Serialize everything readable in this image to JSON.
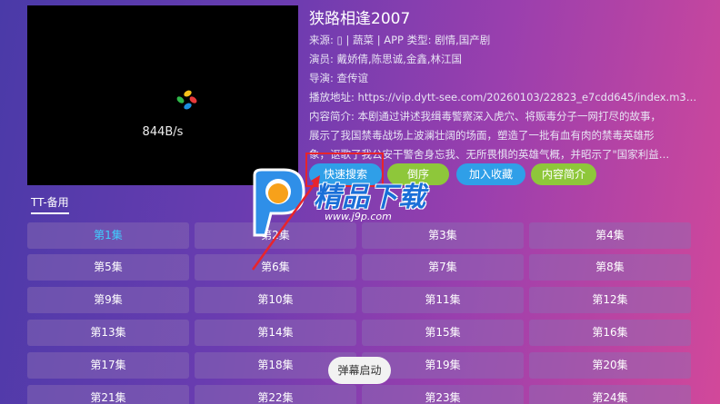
{
  "player": {
    "speed": "844B/s"
  },
  "info": {
    "title": "狭路相逢2007",
    "source_row": "来源: ▯ | 蔬菜 | APP  类型: 剧情,国产剧",
    "actors_row": "演员: 戴娇倩,陈思诚,金鑫,林江国",
    "director_row": "导演: 查传谊",
    "url_row": "播放地址: https://vip.dytt-see.com/20260103/22823_e7cdd645/index.m3u...",
    "desc_line1": "内容简介: 本剧通过讲述我缉毒警察深入虎穴、将贩毒分子一网打尽的故事，",
    "desc_line2": "展示了我国禁毒战场上波澜壮阔的场面，塑造了一批有血有肉的禁毒英雄形",
    "desc_line3": "象，讴歌了我公安干警舍身忘我、无所畏惧的英雄气概，并昭示了\"国家利益…"
  },
  "actions": {
    "search": "快速搜索",
    "sort": "倒序",
    "favorite": "加入收藏",
    "intro": "内容简介"
  },
  "source_tab": "TT-备用",
  "episodes": [
    "第1集",
    "第2集",
    "第3集",
    "第4集",
    "第5集",
    "第6集",
    "第7集",
    "第8集",
    "第9集",
    "第10集",
    "第11集",
    "第12集",
    "第13集",
    "第14集",
    "第15集",
    "第16集",
    "第17集",
    "第18集",
    "第19集",
    "第20集",
    "第21集",
    "第22集",
    "第23集",
    "第24集"
  ],
  "active_episode": 0,
  "toast": "弹幕启动",
  "watermark": {
    "text": "精品下载",
    "url": "www.j9p.com"
  },
  "colors": {
    "accent_blue": "#2f9fe8",
    "accent_green": "#8ec73a",
    "highlight_red": "#e8242b",
    "active_text": "#3fd0ff"
  }
}
